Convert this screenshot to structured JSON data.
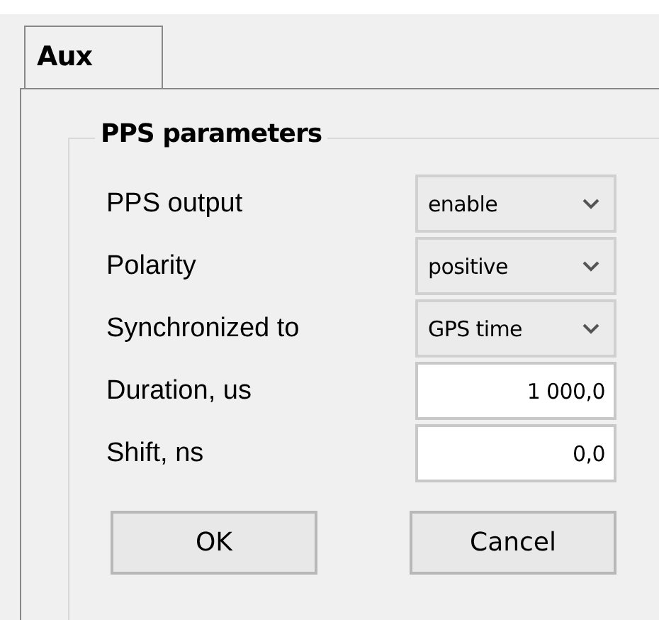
{
  "tabs": [
    {
      "label": "Aux",
      "selected": true
    }
  ],
  "group": {
    "title": "PPS parameters"
  },
  "fields": [
    {
      "label": "PPS output",
      "kind": "dropdown",
      "value": "enable"
    },
    {
      "label": "Polarity",
      "kind": "dropdown",
      "value": "positive"
    },
    {
      "label": "Synchronized to",
      "kind": "dropdown",
      "value": "GPS time"
    },
    {
      "label": "Duration, us",
      "kind": "input",
      "value": "1 000,0"
    },
    {
      "label": "Shift, ns",
      "kind": "input",
      "value": "0,0"
    }
  ],
  "buttons": [
    "OK",
    "Cancel"
  ]
}
